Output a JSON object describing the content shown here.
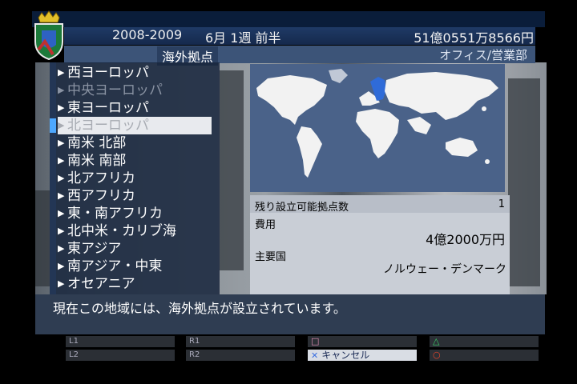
{
  "header": {
    "season": "2008-2009",
    "week": "6月 1週 前半",
    "money": "51億0551万8566円",
    "section_title": "海外拠点",
    "department": "オフィス/営業部"
  },
  "regions": [
    {
      "label": "西ヨーロッパ",
      "state": "normal"
    },
    {
      "label": "中央ヨーロッパ",
      "state": "dim"
    },
    {
      "label": "東ヨーロッパ",
      "state": "normal"
    },
    {
      "label": "北ヨーロッパ",
      "state": "selected"
    },
    {
      "label": "南米 北部",
      "state": "normal"
    },
    {
      "label": "南米 南部",
      "state": "normal"
    },
    {
      "label": "北アフリカ",
      "state": "normal"
    },
    {
      "label": "西アフリカ",
      "state": "normal"
    },
    {
      "label": "東・南アフリカ",
      "state": "normal"
    },
    {
      "label": "北中米・カリブ海",
      "state": "normal"
    },
    {
      "label": "東アジア",
      "state": "normal"
    },
    {
      "label": "南アジア・中東",
      "state": "normal"
    },
    {
      "label": "オセアニア",
      "state": "normal"
    }
  ],
  "info": {
    "remaining_label": "残り設立可能拠点数",
    "remaining_value": "1",
    "cost_label": "費用",
    "cost_value": "4億2000万円",
    "countries_label": "主要国",
    "countries_value": "ノルウェー・デンマーク"
  },
  "message": "現在この地域には、海外拠点が設立されています。",
  "buttons": {
    "l1": "L1",
    "l2": "L2",
    "r1": "R1",
    "r2": "R2",
    "cancel": "キャンセル"
  },
  "colors": {
    "highlight_region": "#2f6bd8",
    "map_sea": "#4a6289",
    "triangle": "#3ad36a",
    "circle": "#e5452b",
    "square": "#e48fb8",
    "cross": "#6fa8ff"
  }
}
